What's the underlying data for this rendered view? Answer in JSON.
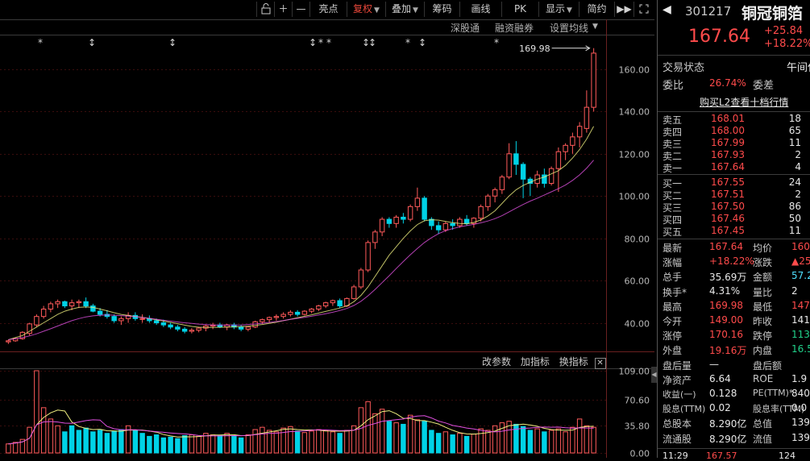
{
  "toolbar": {
    "buttons": [
      {
        "label": "亮点"
      },
      {
        "label": "复权",
        "dropdown": true,
        "active": true
      },
      {
        "label": "叠加",
        "dropdown": true
      },
      {
        "label": "筹码"
      },
      {
        "label": "画线"
      },
      {
        "label": "PK"
      },
      {
        "label": "显示",
        "dropdown": true
      },
      {
        "label": "简约"
      }
    ],
    "icons": [
      "unlock-icon",
      "zoom-in-icon",
      "zoom-out-icon",
      "fast-forward-icon",
      "fullscreen-icon"
    ]
  },
  "chart_header_links": {
    "a": "深股通",
    "b": "融资融券",
    "c": "设置均线"
  },
  "volume_header_links": {
    "a": "改参数",
    "b": "加指标",
    "c": "换指标"
  },
  "price_axis": {
    "ticks": [
      "160.00",
      "140.00",
      "120.00",
      "100.00",
      "80.00",
      "60.00",
      "40.00"
    ]
  },
  "volume_axis": {
    "ticks": [
      "109.00",
      "70.60",
      "35.80",
      "0.00"
    ]
  },
  "max_price_label": "169.98",
  "stock": {
    "code": "301217",
    "name": "铜冠铜箔",
    "price": "167.64",
    "change": "+25.84",
    "change_pct": "+18.22%",
    "status_label": "交易状态",
    "status_value": "午间休市",
    "wei_bi_label": "委比",
    "wei_bi": "26.74%",
    "wei_cha_label": "委差",
    "l2_link": "购买L2查看十档行情"
  },
  "order_book": {
    "sell": [
      {
        "label": "卖五",
        "price": "168.01",
        "vol": "18"
      },
      {
        "label": "卖四",
        "price": "168.00",
        "vol": "65"
      },
      {
        "label": "卖三",
        "price": "167.99",
        "vol": "11"
      },
      {
        "label": "卖二",
        "price": "167.93",
        "vol": "2"
      },
      {
        "label": "卖一",
        "price": "167.64",
        "vol": "4"
      }
    ],
    "buy": [
      {
        "label": "买一",
        "price": "167.55",
        "vol": "24"
      },
      {
        "label": "买二",
        "price": "167.51",
        "vol": "2"
      },
      {
        "label": "买三",
        "price": "167.50",
        "vol": "86"
      },
      {
        "label": "买四",
        "price": "167.46",
        "vol": "50"
      },
      {
        "label": "买五",
        "price": "167.45",
        "vol": "11"
      }
    ]
  },
  "stats": [
    {
      "l1": "最新",
      "v1": "167.64",
      "c1": "red",
      "l2": "均价",
      "v2": "160",
      "c2": "red"
    },
    {
      "l1": "涨幅",
      "v1": "+18.22%",
      "c1": "red",
      "l2": "涨跌",
      "v2": "▲25",
      "c2": "red"
    },
    {
      "l1": "总手",
      "v1": "35.69万",
      "c1": "white",
      "l2": "金额",
      "v2": "57.2",
      "c2": "cyan"
    },
    {
      "l1": "换手*",
      "v1": "4.31%",
      "c1": "white",
      "l2": "量比",
      "v2": "2",
      "c2": "white"
    },
    {
      "l1": "最高",
      "v1": "169.98",
      "c1": "red",
      "l2": "最低",
      "v2": "147",
      "c2": "red"
    },
    {
      "l1": "今开",
      "v1": "149.00",
      "c1": "red",
      "l2": "昨收",
      "v2": "141",
      "c2": "white"
    },
    {
      "l1": "涨停",
      "v1": "170.16",
      "c1": "red",
      "l2": "跌停",
      "v2": "113",
      "c2": "green"
    },
    {
      "l1": "外盘",
      "v1": "19.16万",
      "c1": "red",
      "l2": "内盘",
      "v2": "16.5",
      "c2": "green"
    },
    {
      "l1": "盘后量",
      "v1": "—",
      "c1": "white",
      "l2": "盘后额",
      "v2": "",
      "c2": "white"
    },
    {
      "l1": "净资产",
      "v1": "6.64",
      "c1": "white",
      "l2": "ROE",
      "v2": "1.9",
      "c2": "white"
    },
    {
      "l1": "收益(一)",
      "v1": "0.128",
      "c1": "white",
      "l2": "PE(TTM)*",
      "v2": "840",
      "c2": "white"
    },
    {
      "l1": "股息(TTM)",
      "v1": "0.02",
      "c1": "white",
      "l2": "股息率(TTM)",
      "v2": "0.0",
      "c2": "white"
    },
    {
      "l1": "总股本",
      "v1": "8.290亿",
      "c1": "white",
      "l2": "总值",
      "v2": "139",
      "c2": "white"
    },
    {
      "l1": "流通股",
      "v1": "8.290亿",
      "c1": "white",
      "l2": "流值",
      "v2": "139",
      "c2": "white"
    }
  ],
  "bottom_trade": {
    "time": "11:29",
    "price": "167.57",
    "vol": "124"
  },
  "colors": {
    "up": "#ff4b4b",
    "down": "#00d2e6",
    "up_stroke": "#ff5a5a",
    "ma1": "#f0f080",
    "ma2": "#e050e0"
  },
  "chart_data": {
    "type": "candlestick",
    "ylim": [
      28,
      176
    ],
    "volume_ylim": [
      0,
      109
    ],
    "candles": [
      [
        31,
        32,
        30,
        31.5
      ],
      [
        31.5,
        33,
        31,
        32.5
      ],
      [
        32.5,
        36,
        32,
        35.5
      ],
      [
        35,
        40,
        34,
        39.5
      ],
      [
        39,
        44,
        38,
        43
      ],
      [
        43,
        48,
        42,
        46.5
      ],
      [
        46.5,
        50,
        45,
        49
      ],
      [
        49,
        51,
        47,
        50
      ],
      [
        50,
        50.5,
        47,
        48
      ],
      [
        48,
        51,
        46,
        49.5
      ],
      [
        49.5,
        51,
        47,
        50
      ],
      [
        50,
        52,
        47,
        48
      ],
      [
        48,
        49,
        45,
        45.5
      ],
      [
        45.5,
        47,
        43,
        44
      ],
      [
        44,
        46,
        42,
        43
      ],
      [
        43,
        44,
        40,
        41
      ],
      [
        41,
        43,
        39,
        42
      ],
      [
        42,
        45,
        40,
        43.5
      ],
      [
        43.5,
        45,
        41,
        42
      ],
      [
        42,
        44,
        40,
        42
      ],
      [
        42,
        43.5,
        40,
        41
      ],
      [
        41,
        42,
        39,
        40
      ],
      [
        40,
        41.5,
        38,
        39
      ],
      [
        39,
        40,
        37,
        38
      ],
      [
        38,
        39,
        36,
        37
      ],
      [
        37,
        38,
        35,
        36
      ],
      [
        36,
        37.5,
        35,
        36.5
      ],
      [
        36.5,
        38,
        35.5,
        37.5
      ],
      [
        37.5,
        39,
        36,
        38.5
      ],
      [
        38.5,
        40,
        37,
        39
      ],
      [
        39,
        40,
        37.5,
        38
      ],
      [
        38,
        39.5,
        36.5,
        39
      ],
      [
        39,
        40,
        37,
        38
      ],
      [
        38,
        39,
        36,
        37
      ],
      [
        37,
        38.5,
        36,
        38
      ],
      [
        38,
        41,
        37.5,
        40.5
      ],
      [
        40.5,
        42,
        39.5,
        41.5
      ],
      [
        41.5,
        43,
        40,
        42.5
      ],
      [
        42.5,
        44,
        41,
        43
      ],
      [
        43,
        45,
        42,
        44
      ],
      [
        44,
        46,
        43,
        45
      ],
      [
        45,
        46,
        43,
        44
      ],
      [
        44,
        46,
        43.5,
        45.5
      ],
      [
        45.5,
        47,
        44.5,
        46.5
      ],
      [
        46.5,
        48.5,
        45.5,
        48
      ],
      [
        48,
        50,
        47,
        49.5
      ],
      [
        49.5,
        51,
        48,
        50.5
      ],
      [
        50.5,
        51.5,
        47,
        48
      ],
      [
        48,
        52,
        47.5,
        51.5
      ],
      [
        51.5,
        58,
        51,
        57
      ],
      [
        57,
        66,
        56,
        65
      ],
      [
        65,
        79,
        64,
        78
      ],
      [
        78,
        84,
        75,
        83
      ],
      [
        83,
        90,
        81,
        89
      ],
      [
        89,
        90,
        85,
        87
      ],
      [
        87,
        91,
        85,
        90
      ],
      [
        90,
        92,
        87,
        89
      ],
      [
        89,
        96,
        88,
        95
      ],
      [
        95,
        104,
        93,
        99
      ],
      [
        99,
        100,
        88,
        89
      ],
      [
        89,
        90,
        84,
        86
      ],
      [
        86,
        88,
        82,
        84
      ],
      [
        84,
        88,
        83,
        87
      ],
      [
        87,
        89,
        84,
        86
      ],
      [
        86,
        90,
        85,
        89
      ],
      [
        89,
        91,
        86,
        87
      ],
      [
        87,
        90,
        85,
        89.5
      ],
      [
        89.5,
        96,
        88,
        95
      ],
      [
        95,
        101,
        93,
        100
      ],
      [
        100,
        104,
        97,
        103
      ],
      [
        103,
        110,
        101,
        109
      ],
      [
        109,
        125,
        108,
        120
      ],
      [
        120,
        126,
        110,
        115
      ],
      [
        115,
        116,
        99,
        108
      ],
      [
        108,
        109,
        100,
        106
      ],
      [
        106,
        112,
        104,
        110
      ],
      [
        110,
        113,
        104,
        106
      ],
      [
        106,
        114,
        105,
        113
      ],
      [
        113,
        123,
        102,
        121
      ],
      [
        121,
        125,
        117,
        124
      ],
      [
        124,
        130,
        120,
        128
      ],
      [
        128,
        135,
        123,
        133
      ],
      [
        132,
        150,
        130,
        142
      ],
      [
        142,
        170,
        140,
        167.64
      ]
    ],
    "volumes": [
      [
        12,
        1
      ],
      [
        14,
        1
      ],
      [
        18,
        1
      ],
      [
        34,
        1
      ],
      [
        109,
        1
      ],
      [
        60,
        1
      ],
      [
        45,
        1
      ],
      [
        36,
        1
      ],
      [
        28,
        -1
      ],
      [
        36,
        -1
      ],
      [
        30,
        -1
      ],
      [
        33,
        -1
      ],
      [
        28,
        -1
      ],
      [
        30,
        -1
      ],
      [
        26,
        -1
      ],
      [
        29,
        -1
      ],
      [
        31,
        -1
      ],
      [
        36,
        1
      ],
      [
        30,
        -1
      ],
      [
        26,
        -1
      ],
      [
        22,
        -1
      ],
      [
        24,
        -1
      ],
      [
        20,
        -1
      ],
      [
        21,
        -1
      ],
      [
        19,
        -1
      ],
      [
        23,
        -1
      ],
      [
        24,
        1
      ],
      [
        22,
        1
      ],
      [
        26,
        1
      ],
      [
        24,
        1
      ],
      [
        23,
        -1
      ],
      [
        26,
        1
      ],
      [
        22,
        -1
      ],
      [
        20,
        -1
      ],
      [
        24,
        1
      ],
      [
        31,
        1
      ],
      [
        34,
        1
      ],
      [
        30,
        1
      ],
      [
        28,
        1
      ],
      [
        33,
        1
      ],
      [
        35,
        1
      ],
      [
        29,
        -1
      ],
      [
        27,
        1
      ],
      [
        29,
        1
      ],
      [
        31,
        1
      ],
      [
        30,
        1
      ],
      [
        28,
        1
      ],
      [
        26,
        -1
      ],
      [
        30,
        1
      ],
      [
        36,
        1
      ],
      [
        60,
        1
      ],
      [
        68,
        1
      ],
      [
        52,
        1
      ],
      [
        58,
        1
      ],
      [
        42,
        -1
      ],
      [
        40,
        1
      ],
      [
        38,
        -1
      ],
      [
        50,
        1
      ],
      [
        44,
        1
      ],
      [
        42,
        -1
      ],
      [
        30,
        -1
      ],
      [
        26,
        -1
      ],
      [
        28,
        1
      ],
      [
        24,
        -1
      ],
      [
        26,
        1
      ],
      [
        22,
        -1
      ],
      [
        25,
        1
      ],
      [
        32,
        1
      ],
      [
        30,
        1
      ],
      [
        36,
        1
      ],
      [
        40,
        1
      ],
      [
        42,
        1
      ],
      [
        38,
        -1
      ],
      [
        35,
        -1
      ],
      [
        30,
        -1
      ],
      [
        32,
        1
      ],
      [
        28,
        -1
      ],
      [
        30,
        1
      ],
      [
        32,
        1
      ],
      [
        28,
        1
      ],
      [
        34,
        1
      ],
      [
        45,
        1
      ],
      [
        36,
        1
      ],
      [
        34,
        1
      ]
    ],
    "ma_price_1": [
      32,
      33,
      34,
      36,
      38,
      40,
      42,
      44,
      45.5,
      46.5,
      47.3,
      47.5,
      47.3,
      46.5,
      45.7,
      44.8,
      44,
      43.5,
      43,
      42.6,
      42,
      41.4,
      40.8,
      40.2,
      39.6,
      38.9,
      38.3,
      37.9,
      37.8,
      37.8,
      37.9,
      38,
      38.1,
      38.2,
      38.4,
      38.8,
      39.2,
      39.7,
      40.3,
      41,
      41.7,
      42.4,
      43.1,
      43.8,
      44.6,
      45.4,
      46.2,
      47,
      48,
      50,
      53,
      57,
      62,
      67,
      72,
      76,
      80,
      83.5,
      86.5,
      88.3,
      88.8,
      88.6,
      88,
      87.4,
      87,
      86.8,
      87.5,
      88.7,
      90.6,
      93,
      96.5,
      100,
      103,
      105,
      106.5,
      108,
      109,
      110.5,
      112,
      114.5,
      118,
      122,
      127,
      133
    ],
    "ma_price_2": [
      32,
      32.5,
      33,
      33.8,
      34.8,
      36,
      37.2,
      38.5,
      39.8,
      41,
      42,
      42.8,
      43.3,
      43.6,
      43.7,
      43.6,
      43.4,
      43.2,
      42.9,
      42.5,
      42.1,
      41.7,
      41.2,
      40.8,
      40.4,
      40,
      39.7,
      39.4,
      39.2,
      39,
      38.9,
      38.9,
      38.9,
      39,
      39.2,
      39.5,
      39.8,
      40.2,
      40.6,
      41.1,
      41.6,
      42.1,
      42.6,
      43.1,
      43.7,
      44.3,
      45,
      45.8,
      46.8,
      48.2,
      50.2,
      52.8,
      55.8,
      59,
      62.3,
      65.7,
      69,
      72.2,
      75.2,
      78,
      80.3,
      82.2,
      83.6,
      84.6,
      85.4,
      86,
      86.6,
      87.3,
      88.2,
      89.3,
      90.7,
      92.5,
      94.3,
      96,
      97.6,
      99,
      100.5,
      102,
      103.5,
      105.2,
      107.4,
      110,
      113.2,
      117
    ]
  }
}
